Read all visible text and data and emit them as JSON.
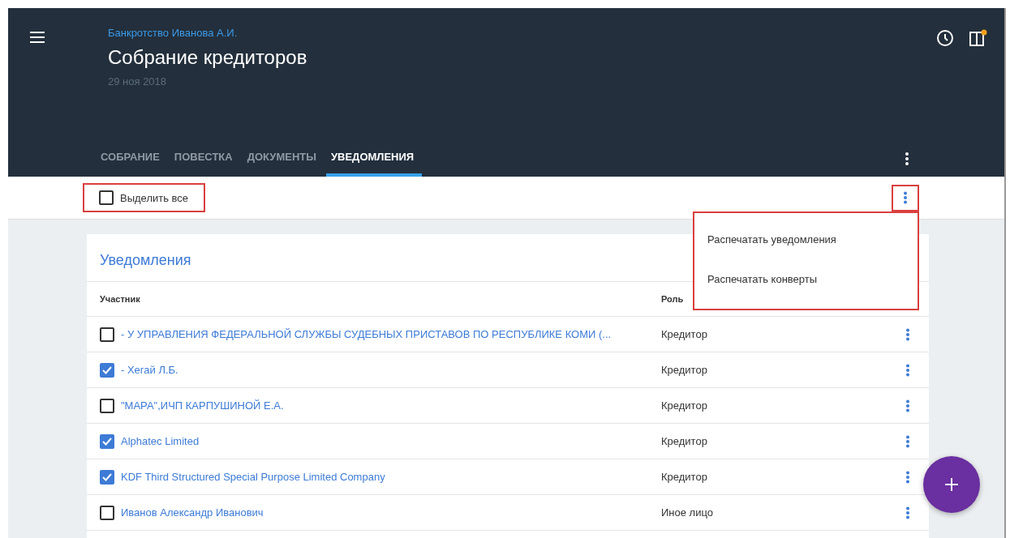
{
  "header": {
    "breadcrumb": "Банкротство Иванова А.И.",
    "title": "Собрание кредиторов",
    "date": "29 ноя 2018"
  },
  "tabs": [
    {
      "label": "СОБРАНИЕ",
      "selected": false
    },
    {
      "label": "ПОВЕСТКА",
      "selected": false
    },
    {
      "label": "ДОКУМЕНТЫ",
      "selected": false
    },
    {
      "label": "УВЕДОМЛЕНИЯ",
      "selected": true
    }
  ],
  "toolbar": {
    "select_all": {
      "label": "Выделить все",
      "checked": false
    },
    "menu": {
      "open": true,
      "items": [
        "Распечатать уведомления",
        "Распечатать конверты"
      ]
    }
  },
  "card": {
    "title": "Уведомления",
    "columns": [
      "Участник",
      "Роль"
    ],
    "rows": [
      {
        "name": "- У УПРАВЛЕНИЯ ФЕДЕРАЛЬНОЙ СЛУЖБЫ СУДЕБНЫХ ПРИСТАВОВ ПО РЕСПУБЛИКЕ КОМИ (...",
        "role": "Кредитор",
        "checked": false
      },
      {
        "name": "- Хегай Л.Б.",
        "role": "Кредитор",
        "checked": true
      },
      {
        "name": "\"МАРА\",ИЧП КАРПУШИНОЙ Е.А.",
        "role": "Кредитор",
        "checked": false
      },
      {
        "name": "Alphatec Limited",
        "role": "Кредитор",
        "checked": true
      },
      {
        "name": "KDF Third Structured Special Purpose Limited Company",
        "role": "Кредитор",
        "checked": true
      },
      {
        "name": "Иванов Александр Иванович",
        "role": "Иное лицо",
        "checked": false
      }
    ]
  }
}
